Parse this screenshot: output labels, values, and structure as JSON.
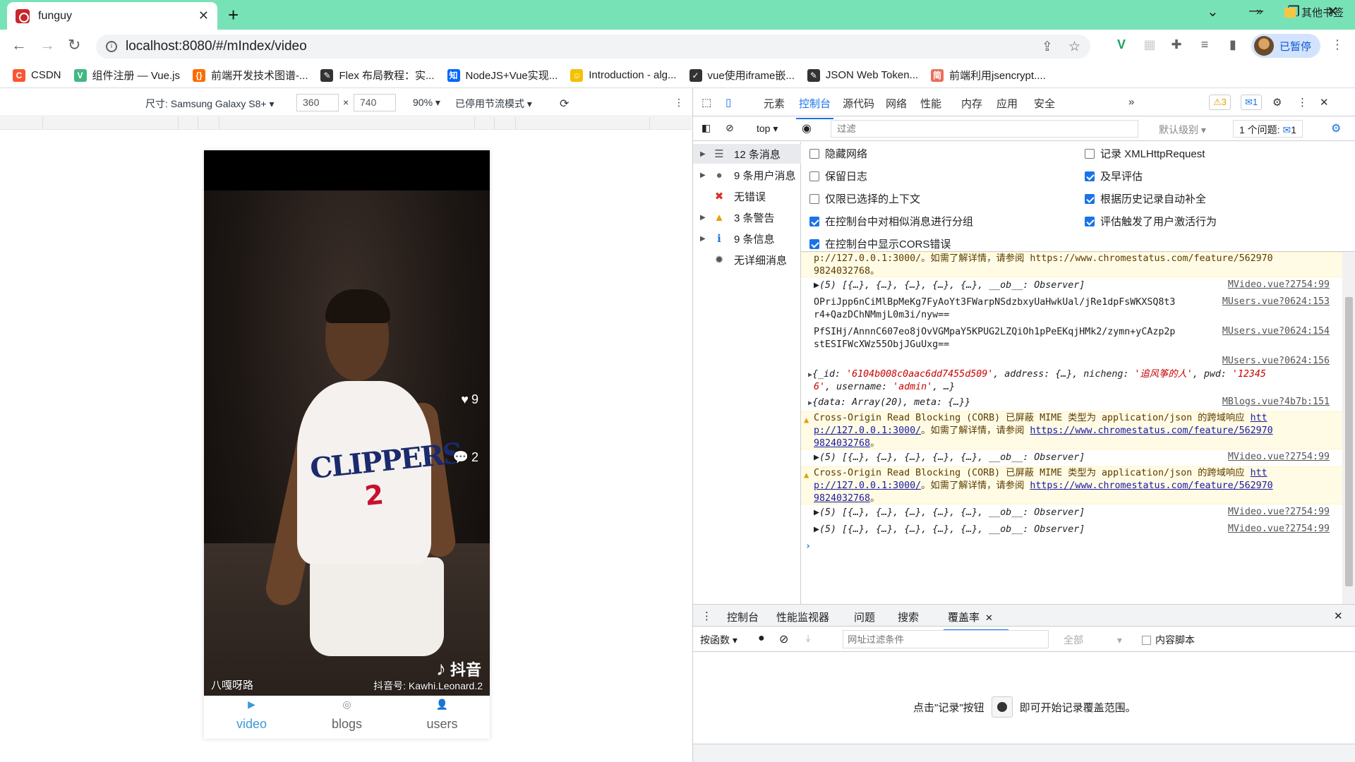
{
  "browser": {
    "tab_title": "funguy",
    "url": "localhost:8080/#/mIndex/video",
    "profile_label": "已暂停"
  },
  "bookmarks": [
    {
      "label": "CSDN",
      "icon": "csdn-icon",
      "color": "#fc5531"
    },
    {
      "label": "组件注册 — Vue.js",
      "icon": "vue-icon",
      "color": "#41b883"
    },
    {
      "label": "前端开发技术图谱-...",
      "icon": "bracket-icon",
      "color": "#ff6a00"
    },
    {
      "label": "Flex 布局教程：实...",
      "icon": "feather-icon",
      "color": "#333333"
    },
    {
      "label": "NodeJS+Vue实现...",
      "icon": "zhihu-icon",
      "color": "#0066ff"
    },
    {
      "label": "Introduction - alg...",
      "icon": "emoji-icon",
      "color": "#f2c200"
    },
    {
      "label": "vue使用iframe嵌...",
      "icon": "yuque-icon",
      "color": "#333333"
    },
    {
      "label": "JSON Web Token...",
      "icon": "feather-icon",
      "color": "#333333"
    },
    {
      "label": "前端利用jsencrypt....",
      "icon": "jianshu-icon",
      "color": "#ea6f5a"
    }
  ],
  "bookmarks_other": "其他书签",
  "device_toolbar": {
    "device_label": "尺寸: Samsung Galaxy S8+",
    "width": "360",
    "height": "740",
    "times": "×",
    "zoom": "90%",
    "throttle": "已停用节流模式"
  },
  "phone": {
    "likes": "9",
    "comments": "2",
    "watermark_left": "八嘎呀路",
    "tiktok_label": "抖音",
    "tiktok_account": "抖音号: Kawhi.Leonard.2",
    "jersey_text": "CLIPPERS",
    "jersey_number": "2",
    "nav": [
      {
        "label": "video",
        "icon": "video-icon",
        "active": true
      },
      {
        "label": "blogs",
        "icon": "blogs-icon",
        "active": false
      },
      {
        "label": "users",
        "icon": "users-icon",
        "active": false
      }
    ]
  },
  "devtools": {
    "tabs": [
      "元素",
      "控制台",
      "源代码",
      "网络",
      "性能",
      "内存",
      "应用",
      "安全"
    ],
    "active_tab": "控制台",
    "more": "»",
    "warn_count": "3",
    "msg_count": "1",
    "context": "top",
    "filter_placeholder": "过滤",
    "levels": "默认级别",
    "issues_label": "1 个问题:",
    "issues_count": "1",
    "sidebar": [
      {
        "label": "12 条消息",
        "icon": "list-icon",
        "arrow": true,
        "selected": true
      },
      {
        "label": "9 条用户消息",
        "icon": "user-icon",
        "arrow": true,
        "selected": false
      },
      {
        "label": "无错误",
        "icon": "error-icon",
        "arrow": false,
        "selected": false
      },
      {
        "label": "3 条警告",
        "icon": "warning-icon",
        "arrow": true,
        "selected": false
      },
      {
        "label": "9 条信息",
        "icon": "info-icon",
        "arrow": true,
        "selected": false
      },
      {
        "label": "无详细消息",
        "icon": "bug-icon",
        "arrow": false,
        "selected": false
      }
    ],
    "settings": [
      {
        "label": "隐藏网络",
        "checked": false
      },
      {
        "label": "记录 XMLHttpRequest",
        "checked": false
      },
      {
        "label": "保留日志",
        "checked": false
      },
      {
        "label": "及早评估",
        "checked": true
      },
      {
        "label": "仅限已选择的上下文",
        "checked": false
      },
      {
        "label": "根据历史记录自动补全",
        "checked": true
      },
      {
        "label": "在控制台中对相似消息进行分组",
        "checked": true
      },
      {
        "label": "评估触发了用户激活行为",
        "checked": true
      },
      {
        "label": "在控制台中显示CORS错误",
        "checked": true
      }
    ],
    "console": {
      "warn_tail_1": "p://127.0.0.1:3000/。如需了解详情，请参阅 https://www.chromestatus.com/feature/562970\n9824032768。",
      "observer_line": "▶(5) [{…}, {…}, {…}, {…}, {…}, __ob__: Observer]",
      "src_mvideo": "MVideo.vue?2754:99",
      "hash1": "OPriJpp6nCiMlBpMeKg7FyAoYt3FWarpNSdzbxyUaHwkUal/jRe1dpFsWKXSQ8t3\nr4+QazDChNMmjL0m3i/nyw==",
      "src_musers_153": "MUsers.vue?0624:153",
      "hash2": "PfSIHj/AnnnC607eo8jOvVGMpaY5KPUG2LZQiOh1pPeEKqjHMk2/zymn+yCAzp2p\nstESIFWcXWz55ObjJGuUxg==",
      "src_musers_154": "MUsers.vue?0624:154",
      "src_musers_156": "MUsers.vue?0624:156",
      "user_obj_1": "{_id: ",
      "user_id": "'6104b008c0aac6dd7455d509'",
      "user_obj_2": ", address: {…}, nicheng: ",
      "user_nicheng": "'追风筝的人'",
      "user_obj_3": ", pwd: ",
      "user_pwd_a": "'12345",
      "user_pwd_b": "6'",
      "user_obj_4": ", username: ",
      "user_username": "'admin'",
      "user_obj_5": ", …}",
      "blogs_line": "{data: Array(20), meta: {…}}",
      "src_mblogs": "MBlogs.vue?4b7b:151",
      "corb_1": "Cross-Origin Read Blocking (CORB) 已屏蔽 MIME 类型为 application/json 的跨域响应 ",
      "corb_htt": "htt",
      "corb_2": "p://127.0.0.1:3000/",
      "corb_3": "。如需了解详情，请参阅 ",
      "corb_link": "https://www.chromestatus.com/feature/562970",
      "corb_4": "9824032768",
      "corb_5": "。",
      "prompt": "›"
    },
    "drawer": {
      "tabs": [
        "控制台",
        "性能监视器",
        "问题",
        "搜索",
        "覆盖率"
      ],
      "active": "覆盖率",
      "per_function": "按函数",
      "url_filter_placeholder": "网址过滤条件",
      "all": "全部",
      "content_scripts": "内容脚本",
      "msg_before": "点击\"记录\"按钮",
      "msg_after": "即可开始记录覆盖范围。"
    }
  }
}
